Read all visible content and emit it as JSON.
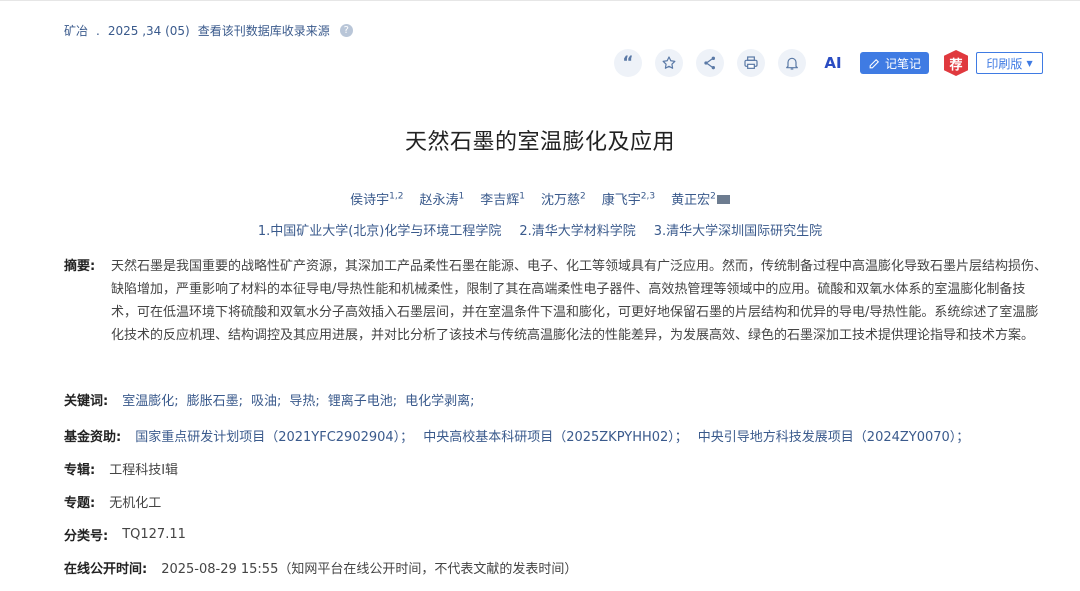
{
  "source": {
    "journal": "矿冶",
    "issue": "2025 ,34 (05)",
    "db_link": "查看该刊数据库收录来源"
  },
  "toolbar": {
    "note_label": "记笔记",
    "rec_label": "荐",
    "print_label": "印刷版",
    "ai_label": "AI"
  },
  "article": {
    "title": "天然石墨的室温膨化及应用",
    "authors": [
      {
        "name": "侯诗宇",
        "sup": "1,2"
      },
      {
        "name": "赵永涛",
        "sup": "1"
      },
      {
        "name": "李吉辉",
        "sup": "1"
      },
      {
        "name": "沈万慈",
        "sup": "2"
      },
      {
        "name": "康飞宇",
        "sup": "2,3"
      },
      {
        "name": "黄正宏",
        "sup": "2"
      }
    ],
    "affiliations": [
      "1.中国矿业大学(北京)化学与环境工程学院",
      "2.清华大学材料学院",
      "3.清华大学深圳国际研究生院"
    ],
    "abstract_label": "摘要:",
    "abstract": "天然石墨是我国重要的战略性矿产资源，其深加工产品柔性石墨在能源、电子、化工等领域具有广泛应用。然而，传统制备过程中高温膨化导致石墨片层结构损伤、缺陷增加，严重影响了材料的本征导电/导热性能和机械柔性，限制了其在高端柔性电子器件、高效热管理等领域中的应用。硫酸和双氧水体系的室温膨化制备技术，可在低温环境下将硫酸和双氧水分子高效插入石墨层间，并在室温条件下温和膨化，可更好地保留石墨的片层结构和优异的导电/导热性能。系统综述了室温膨化技术的反应机理、结构调控及其应用进展，并对比分析了该技术与传统高温膨化法的性能差异，为发展高效、绿色的石墨深加工技术提供理论指导和技术方案。",
    "keywords_label": "关键词:",
    "keywords": [
      "室温膨化;",
      "膨胀石墨;",
      "吸油;",
      "导热;",
      "锂离子电池;",
      "电化学剥离;"
    ],
    "funding_label": "基金资助:",
    "funding": [
      "国家重点研发计划项目（2021YFC2902904）；",
      "中央高校基本科研项目（2025ZKPYHH02）；",
      "中央引导地方科技发展项目（2024ZY0070）；"
    ],
    "series_label": "专辑:",
    "series": "工程科技Ⅰ辑",
    "topic_label": "专题:",
    "topic": "无机化工",
    "class_label": "分类号:",
    "class_no": "TQ127.11",
    "online_label": "在线公开时间:",
    "online_time": "2025-08-29 15:55（知网平台在线公开时间，不代表文献的发表时间）"
  }
}
